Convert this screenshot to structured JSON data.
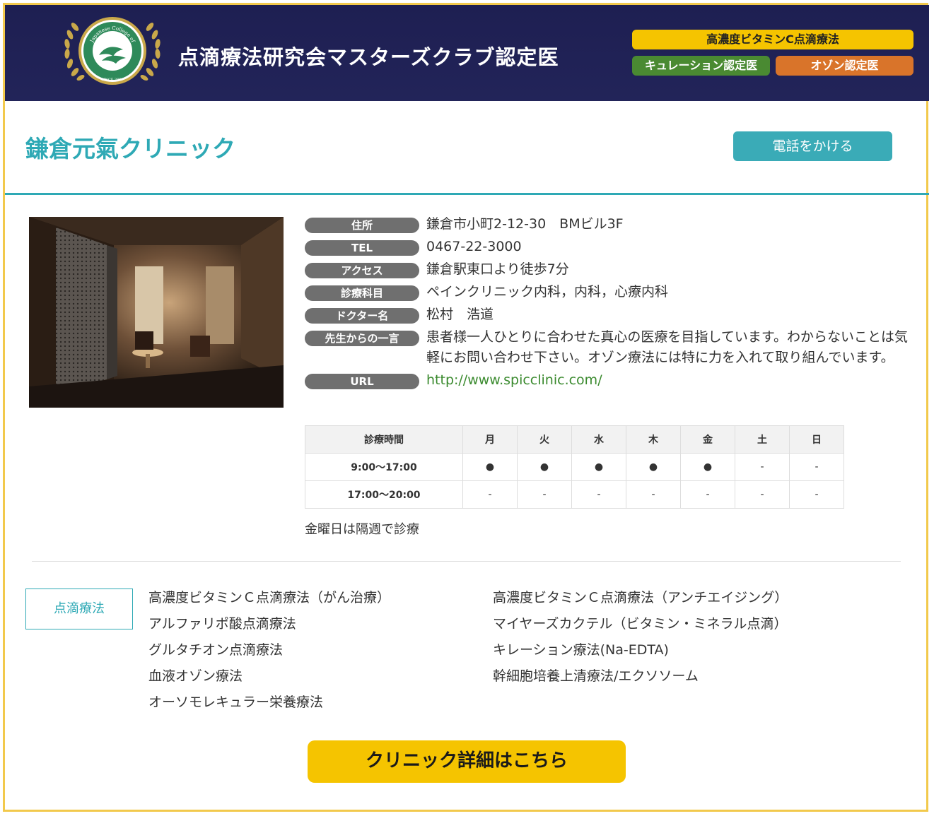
{
  "header": {
    "title": "点滴療法研究会マスターズクラブ認定医",
    "badges": {
      "vitamin_c": "高濃度ビタミンC点滴療法",
      "chelation": "キュレーション認定医",
      "ozone": "オゾン認定医"
    }
  },
  "clinic": {
    "name": "鎌倉元氣クリニック",
    "call_button": "電話をかける"
  },
  "info": [
    {
      "label": "住所",
      "value": "鎌倉市小町2-12-30　BMビル3F"
    },
    {
      "label": "TEL",
      "value": "0467-22-3000"
    },
    {
      "label": "アクセス",
      "value": "鎌倉駅東口より徒歩7分"
    },
    {
      "label": "診療科目",
      "value": "ペインクリニック内科，内科，心療内科"
    },
    {
      "label": "ドクター名",
      "value": "松村　浩道"
    },
    {
      "label": "先生からの一言",
      "value": "患者様一人ひとりに合わせた真心の医療を目指しています。わからないことは気軽にお問い合わせ下さい。オゾン療法には特に力を入れて取り組んでいます。"
    },
    {
      "label": "URL",
      "value": "http://www.spicclinic.com/"
    }
  ],
  "hours": {
    "header": [
      "診療時間",
      "月",
      "火",
      "水",
      "木",
      "金",
      "土",
      "日"
    ],
    "rows": [
      [
        "9:00〜17:00",
        "●",
        "●",
        "●",
        "●",
        "●",
        "-",
        "-"
      ],
      [
        "17:00〜20:00",
        "-",
        "-",
        "-",
        "-",
        "-",
        "-",
        "-"
      ]
    ],
    "note": "金曜日は隔週で診療"
  },
  "therapies": {
    "tag": "点滴療法",
    "col_a": [
      "高濃度ビタミンＣ点滴療法（がん治療）",
      "アルファリポ酸点滴療法",
      "グルタチオン点滴療法",
      "血液オゾン療法",
      "オーソモレキュラー栄養療法"
    ],
    "col_b": [
      "高濃度ビタミンＣ点滴療法（アンチエイジング）",
      "マイヤーズカクテル（ビタミン・ミネラル点滴）",
      "キレーション療法(Na-EDTA)",
      "幹細胞培養上清療法/エクソソーム"
    ]
  },
  "detail_button": "クリニック詳細はこちら",
  "logo": {
    "text_top": "Japanese College of",
    "text_bottom": "Intravenous Therapy",
    "since": "SINCE 2007"
  }
}
